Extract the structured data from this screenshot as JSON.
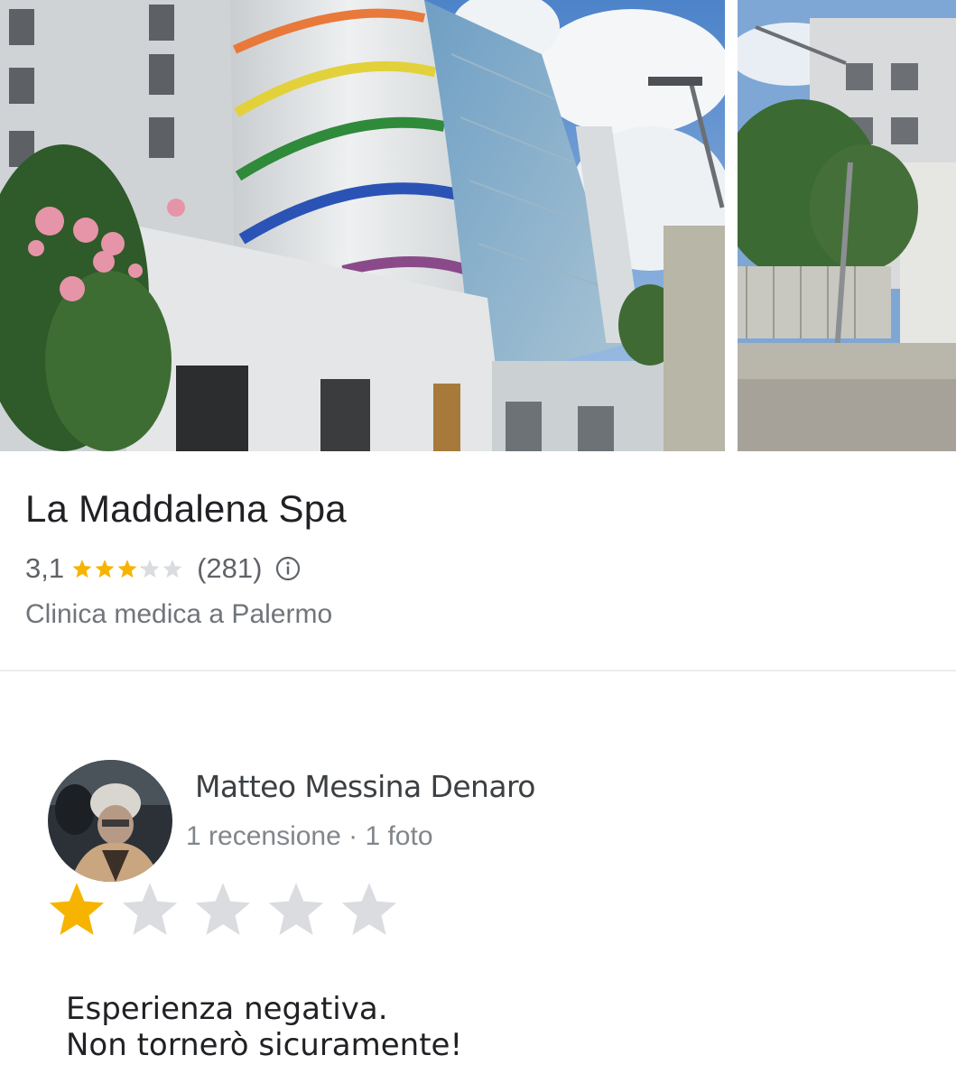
{
  "place": {
    "name": "La Maddalena Spa",
    "rating_text": "3,1",
    "rating_value": 3.1,
    "review_count": "(281)",
    "category": "Clinica medica a Palermo"
  },
  "review": {
    "author_name": "Matteo Messina Denaro",
    "author_meta": "1 recensione · 1 foto",
    "stars": 1,
    "text_line1": "Esperienza negativa.",
    "text_line2": "Non tornerò sicuramente!"
  },
  "colors": {
    "star_filled": "#f6b400",
    "star_empty": "#dadce0"
  },
  "icons": {
    "info": "info-icon",
    "star": "star-icon"
  }
}
